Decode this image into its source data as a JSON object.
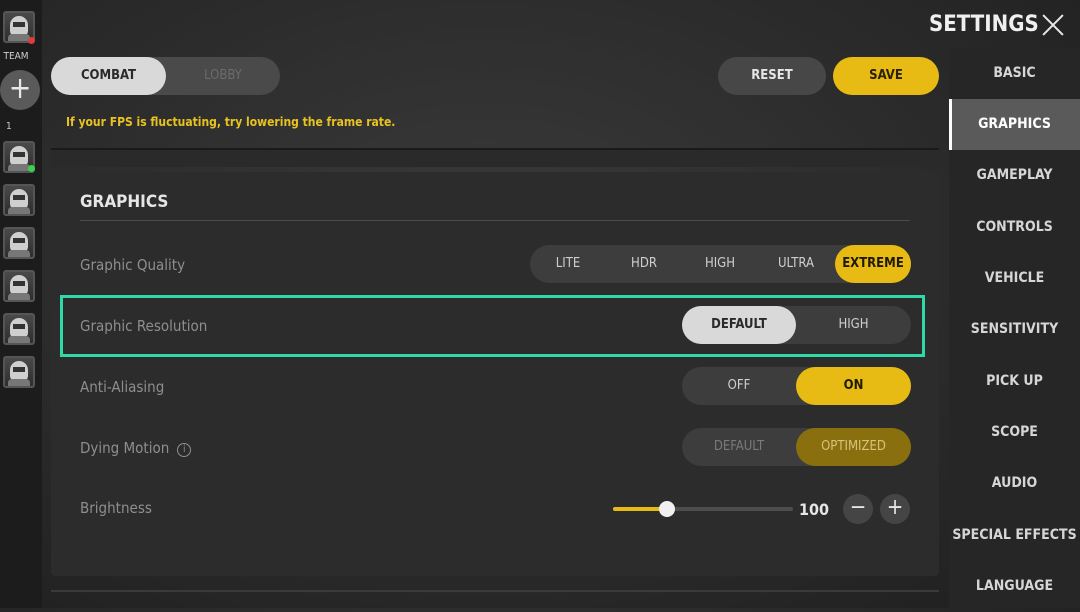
{
  "team": {
    "label": "TEAM",
    "count": "1",
    "add_icon": "plus-icon"
  },
  "tabs": {
    "combat": "COMBAT",
    "lobby": "LOBBY",
    "selected": "COMBAT"
  },
  "hint": "If your FPS is fluctuating, try lowering the frame rate.",
  "actions": {
    "reset": "RESET",
    "save": "SAVE"
  },
  "header": {
    "title": "SETTINGS",
    "close_icon": "close-icon"
  },
  "graphics": {
    "title": "GRAPHICS",
    "graphic_quality": {
      "label": "Graphic Quality",
      "options": [
        "LITE",
        "HDR",
        "HIGH",
        "ULTRA",
        "EXTREME"
      ],
      "selected": "EXTREME"
    },
    "graphic_resolution": {
      "label": "Graphic Resolution",
      "options": [
        "DEFAULT",
        "HIGH"
      ],
      "selected": "DEFAULT"
    },
    "anti_aliasing": {
      "label": "Anti-Aliasing",
      "options": [
        "OFF",
        "ON"
      ],
      "selected": "ON"
    },
    "dying_motion": {
      "label": "Dying Motion",
      "info_icon": "info-icon",
      "info_glyph": "i",
      "options": [
        "DEFAULT",
        "OPTIMIZED"
      ],
      "selected": "OPTIMIZED"
    },
    "brightness": {
      "label": "Brightness",
      "value": "100",
      "level": 0.3,
      "minus": "−",
      "plus": "+"
    }
  },
  "menu": {
    "items": [
      "BASIC",
      "GRAPHICS",
      "GAMEPLAY",
      "CONTROLS",
      "VEHICLE",
      "SENSITIVITY",
      "PICK UP",
      "SCOPE",
      "AUDIO",
      "SPECIAL EFFECTS",
      "LANGUAGE"
    ],
    "active": "GRAPHICS"
  },
  "colors": {
    "accent": "#e7bb14",
    "highlight": "#2fd9a8",
    "online": "#39d24a"
  }
}
